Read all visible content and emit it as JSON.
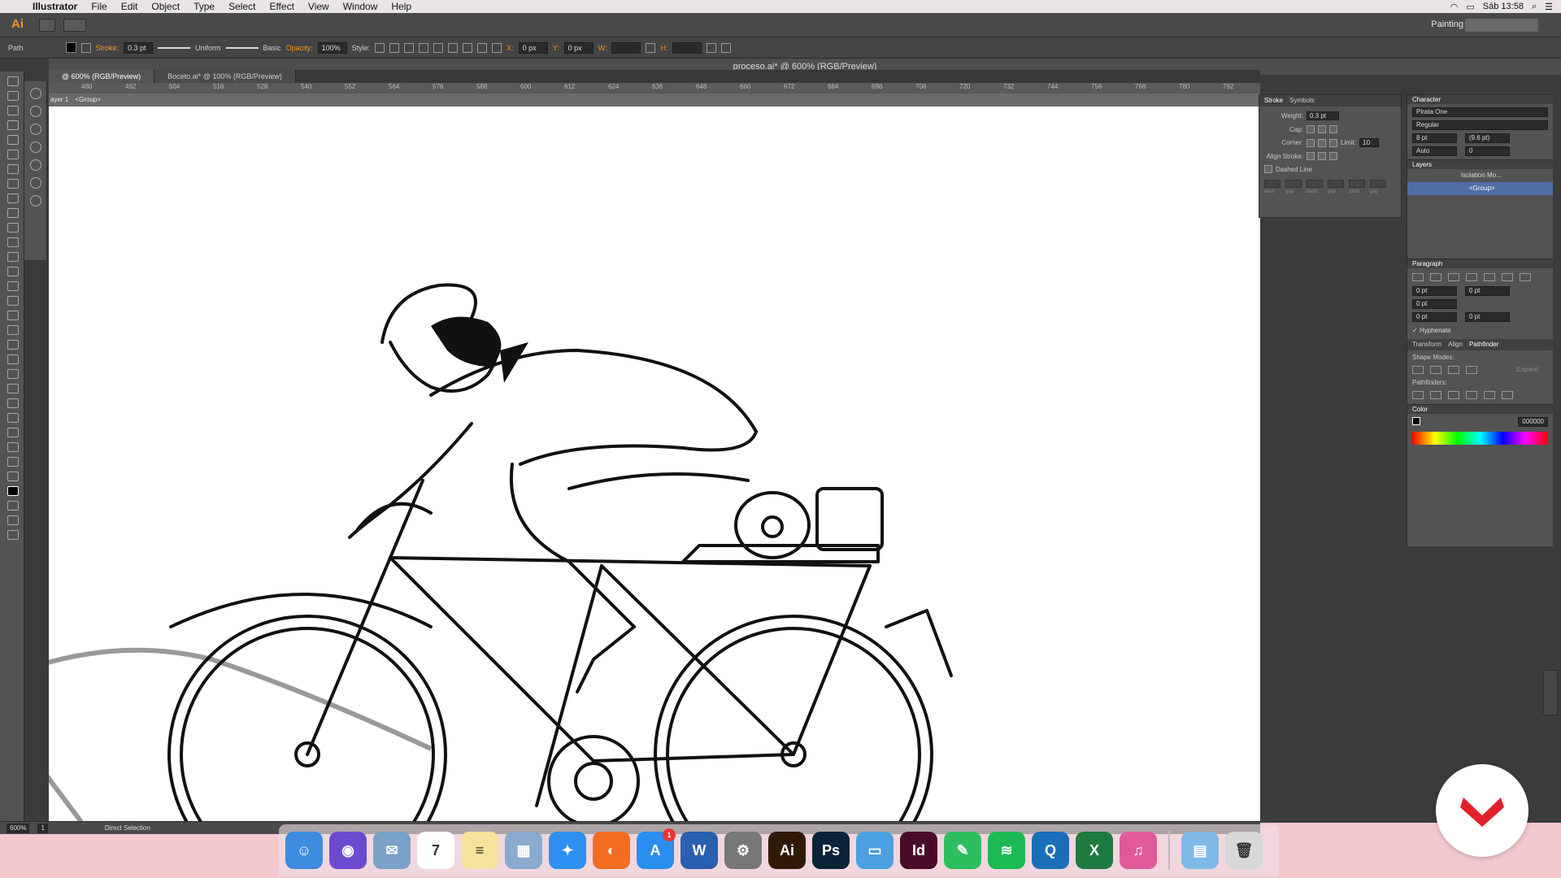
{
  "menubar": {
    "apple": "",
    "items": [
      "Illustrator",
      "File",
      "Edit",
      "Object",
      "Type",
      "Select",
      "Effect",
      "View",
      "Window",
      "Help"
    ],
    "clock": "Sáb 13:58"
  },
  "appbar": {
    "logo": "Ai",
    "workspace": "Painting"
  },
  "control": {
    "type_label": "Path",
    "stroke_label": "Stroke:",
    "stroke_value": "0.3 pt",
    "profile": "Uniform",
    "brush": "Basic",
    "opacity_label": "Opacity:",
    "opacity_value": "100%",
    "style_label": "Style:",
    "x_label": "X:",
    "x_value": "0 px",
    "y_label": "Y:",
    "y_value": "0 px",
    "w_label": "W:",
    "h_label": "H:"
  },
  "window_title": "proceso.ai* @ 600% (RGB/Preview)",
  "tabs": [
    {
      "label": "@ 600% (RGB/Preview)"
    },
    {
      "label": "Boceto.ai* @ 100% (RGB/Preview)"
    }
  ],
  "ruler": [
    "480",
    "492",
    "504",
    "516",
    "528",
    "540",
    "552",
    "564",
    "576",
    "588",
    "600",
    "612",
    "624",
    "636",
    "648",
    "660",
    "672",
    "684",
    "696",
    "708",
    "720",
    "732",
    "744",
    "756",
    "768",
    "780",
    "792",
    "80"
  ],
  "breadcrumb": {
    "layer": "ayer 1",
    "group": "<Group>"
  },
  "stroke_panel": {
    "tab1": "Stroke",
    "tab2": "Symbols",
    "weight_label": "Weight:",
    "weight_value": "0.3 pt",
    "cap_label": "Cap:",
    "corner_label": "Corner:",
    "limit_label": "Limit:",
    "limit_value": "10",
    "align_label": "Align Stroke:",
    "dashed_label": "Dashed Line",
    "dash_labels": [
      "dash",
      "gap",
      "dash",
      "gap",
      "dash",
      "gap"
    ]
  },
  "character_panel": {
    "title": "Character",
    "font": "Pirata One",
    "style": "Regular",
    "size": "8 pt",
    "leading": "(9.6 pt)",
    "kerning": "Auto",
    "tracking": "0"
  },
  "layers_panel": {
    "title": "Layers",
    "rows": [
      "Isolation Mo...",
      "<Group>"
    ]
  },
  "paragraph_panel": {
    "title": "Paragraph",
    "indent_left": "0 pt",
    "indent_right": "0 pt",
    "first_line": "0 pt",
    "space_before": "0 pt",
    "space_after": "0 pt",
    "hyphenate": "Hyphenate"
  },
  "pathfinder_panel": {
    "tabs": [
      "Transform",
      "Align",
      "Pathfinder"
    ],
    "shape_modes": "Shape Modes:",
    "expand": "Expand",
    "pathfinders": "Pathfinders:"
  },
  "color_panel": {
    "title": "Color",
    "hex": "000000"
  },
  "statusbar": {
    "zoom": "600%",
    "page": "1",
    "tool": "Direct Selection"
  },
  "dock": [
    {
      "name": "Finder",
      "glyph": "☺",
      "color": "#3d8be0"
    },
    {
      "name": "Siri",
      "glyph": "◉",
      "color": "#6a4bd0"
    },
    {
      "name": "Preview",
      "glyph": "✉",
      "color": "#7aa0c8"
    },
    {
      "name": "Calendar",
      "glyph": "7",
      "color": "#ffffff"
    },
    {
      "name": "Notes",
      "glyph": "≡",
      "color": "#f6e39a"
    },
    {
      "name": "Photos",
      "glyph": "▦",
      "color": "#8aaad0"
    },
    {
      "name": "Safari",
      "glyph": "✦",
      "color": "#2d8ff0"
    },
    {
      "name": "Firefox",
      "glyph": "◐",
      "color": "#f36c21"
    },
    {
      "name": "App Store",
      "glyph": "A",
      "color": "#2a8ef0",
      "badge": "1"
    },
    {
      "name": "Word",
      "glyph": "W",
      "color": "#2b5fb0"
    },
    {
      "name": "System Preferences",
      "glyph": "⚙",
      "color": "#777777"
    },
    {
      "name": "Illustrator",
      "glyph": "Ai",
      "color": "#2e1a05"
    },
    {
      "name": "Photoshop",
      "glyph": "Ps",
      "color": "#0a2339"
    },
    {
      "name": "Keynote",
      "glyph": "▭",
      "color": "#4aa0e0"
    },
    {
      "name": "InDesign",
      "glyph": "Id",
      "color": "#4a0b2a"
    },
    {
      "name": "Evernote",
      "glyph": "✎",
      "color": "#2dbe60"
    },
    {
      "name": "Spotify",
      "glyph": "≋",
      "color": "#1db954"
    },
    {
      "name": "QuickTime",
      "glyph": "Q",
      "color": "#1a6fb8"
    },
    {
      "name": "Excel",
      "glyph": "X",
      "color": "#1f7a3f"
    },
    {
      "name": "iTunes",
      "glyph": "♫",
      "color": "#e05a9a"
    },
    {
      "name": "Downloads",
      "glyph": "▤",
      "color": "#7fb9e8"
    },
    {
      "name": "Trash",
      "glyph": "🗑",
      "color": "#d8d8d8"
    }
  ],
  "colors": {
    "accent": "#f7941e",
    "brand_red": "#e3202a",
    "layer_select": "#4f6ea3"
  }
}
